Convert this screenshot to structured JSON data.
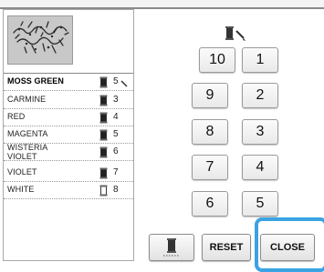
{
  "threads": [
    {
      "name": "MOSS GREEN",
      "num": "5",
      "color": "#222222",
      "current": true
    },
    {
      "name": "CARMINE",
      "num": "3",
      "color": "#222222"
    },
    {
      "name": "RED",
      "num": "4",
      "color": "#222222"
    },
    {
      "name": "MAGENTA",
      "num": "5",
      "color": "#222222"
    },
    {
      "name": "WISTERIA VIOLET",
      "num": "6",
      "color": "#222222"
    },
    {
      "name": "VIOLET",
      "num": "7",
      "color": "#222222"
    },
    {
      "name": "WHITE",
      "num": "8",
      "color": "#ffffff"
    }
  ],
  "keypad": {
    "left": [
      "10",
      "9",
      "8",
      "7",
      "6"
    ],
    "right": [
      "1",
      "2",
      "3",
      "4",
      "5"
    ]
  },
  "buttons": {
    "reset": "RESET",
    "close": "CLOSE"
  },
  "icons": {
    "preview": "embroidery-pattern-preview",
    "edit": "spool-pencil-icon",
    "thread": "thread-spool-icon",
    "spool_button": "spool-settings-icon"
  },
  "colors": {
    "highlight": "#3aa3e3"
  }
}
